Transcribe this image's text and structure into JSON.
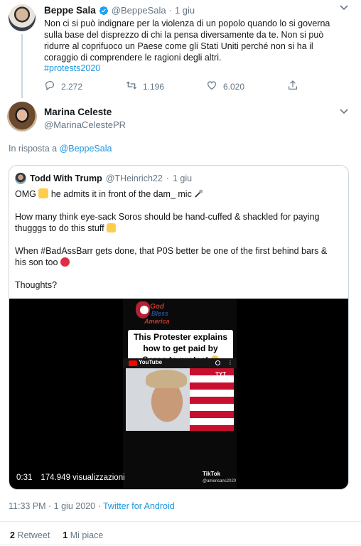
{
  "original_tweet": {
    "author_name": "Beppe Sala",
    "verified": true,
    "handle": "@BeppeSala",
    "separator": "·",
    "date": "1 giu",
    "text": "Non ci si può indignare per la violenza di un popolo quando lo si governa sulla base del disprezzo di chi la pensa diversamente da te. Non si può ridurre al coprifuoco un Paese come gli Stati Uniti perché non si ha il coraggio di comprendere le ragioni degli altri.",
    "hashtag": "#protests2020",
    "replies": "2.272",
    "retweets": "1.196",
    "likes": "6.020"
  },
  "reply_tweet": {
    "author_name": "Marina Celeste",
    "handle": "@MarinaCelestePR",
    "reply_prefix": "In risposta a",
    "reply_to": "@BeppeSala",
    "quoted": {
      "author_name": "Todd With Trump",
      "handle": "@THeinrich22",
      "separator": "·",
      "date": "1 giu",
      "line1_a": "OMG",
      "line1_b": "he admits it in front of the dam_ mic",
      "line2": "How many think eye-sack Soros should be hand-cuffed & shackled for paying thugggs to do this stuff",
      "line3": "When #BadAssBarr gets done, that P0S better be one of the first behind bars & his son too",
      "line4": "Thoughts?",
      "video": {
        "overlay_caption": "This Protester explains how to get paid by Soros to protest",
        "logo_text_1": "God",
        "logo_text_2": "Bless",
        "logo_text_3": "America",
        "youtube_label": "YouTube",
        "tyt_label": "TYT",
        "duration": "0:31",
        "views": "174.949 visualizzazioni",
        "tiktok_label": "TikTok",
        "tiktok_handle": "@americans2020"
      }
    },
    "timestamp": "11:33 PM · 1 giu 2020",
    "source_separator": "·",
    "source": "Twitter for Android",
    "retweet_count": "2",
    "retweet_label": "Retweet",
    "like_count": "1",
    "like_label": "Mi piace"
  },
  "colors": {
    "link": "#1b95e0",
    "verified": "#1da1f2",
    "muted": "#657786",
    "border": "#ccd6dd"
  },
  "icons": [
    "verified-icon",
    "chevron-down-icon",
    "reply-icon",
    "retweet-icon",
    "like-icon",
    "share-icon",
    "emoji-scream-icon",
    "emoji-mic-icon",
    "emoji-raise-hand-icon",
    "emoji-angry-icon",
    "emoji-smile-icon"
  ]
}
